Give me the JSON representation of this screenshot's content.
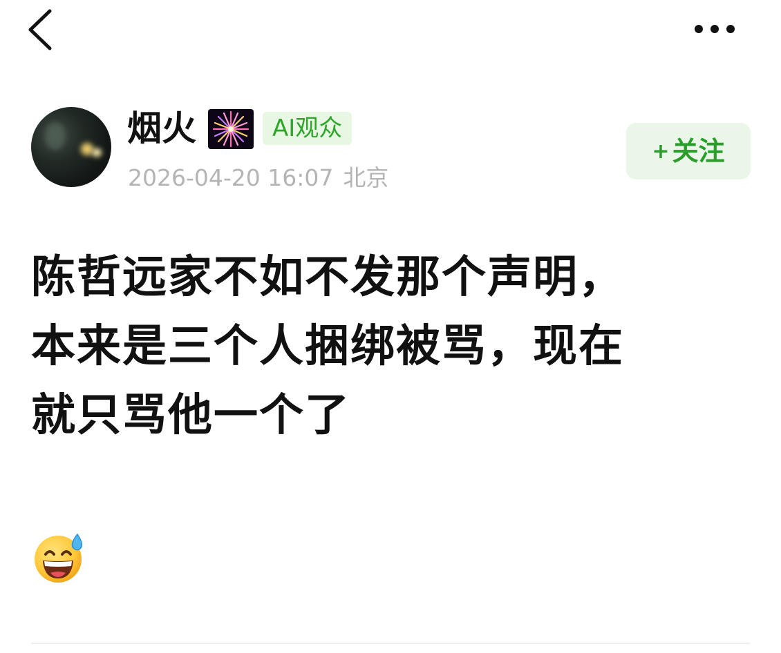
{
  "topbar": {
    "back_icon": "chevron-left-icon",
    "more_icon": "more-dots-icon"
  },
  "author": {
    "nickname": "烟火",
    "nickname_decoration_icon": "fireworks-icon",
    "badge": "AI观众",
    "timestamp": "2026-04-20 16:07",
    "location": "北京",
    "follow_label": "关注",
    "follow_icon": "plus-icon"
  },
  "post": {
    "text": "陈哲远家不如不发那个声明，\n本来是三个人捆绑被骂，现在\n就只骂他一个了",
    "emoji": "grinning-sweat-emoji"
  },
  "colors": {
    "accent_green": "#2a9d2b",
    "badge_bg": "#e7f7e3",
    "follow_bg": "#eaf6e8",
    "meta_gray": "#b4b4b4"
  }
}
